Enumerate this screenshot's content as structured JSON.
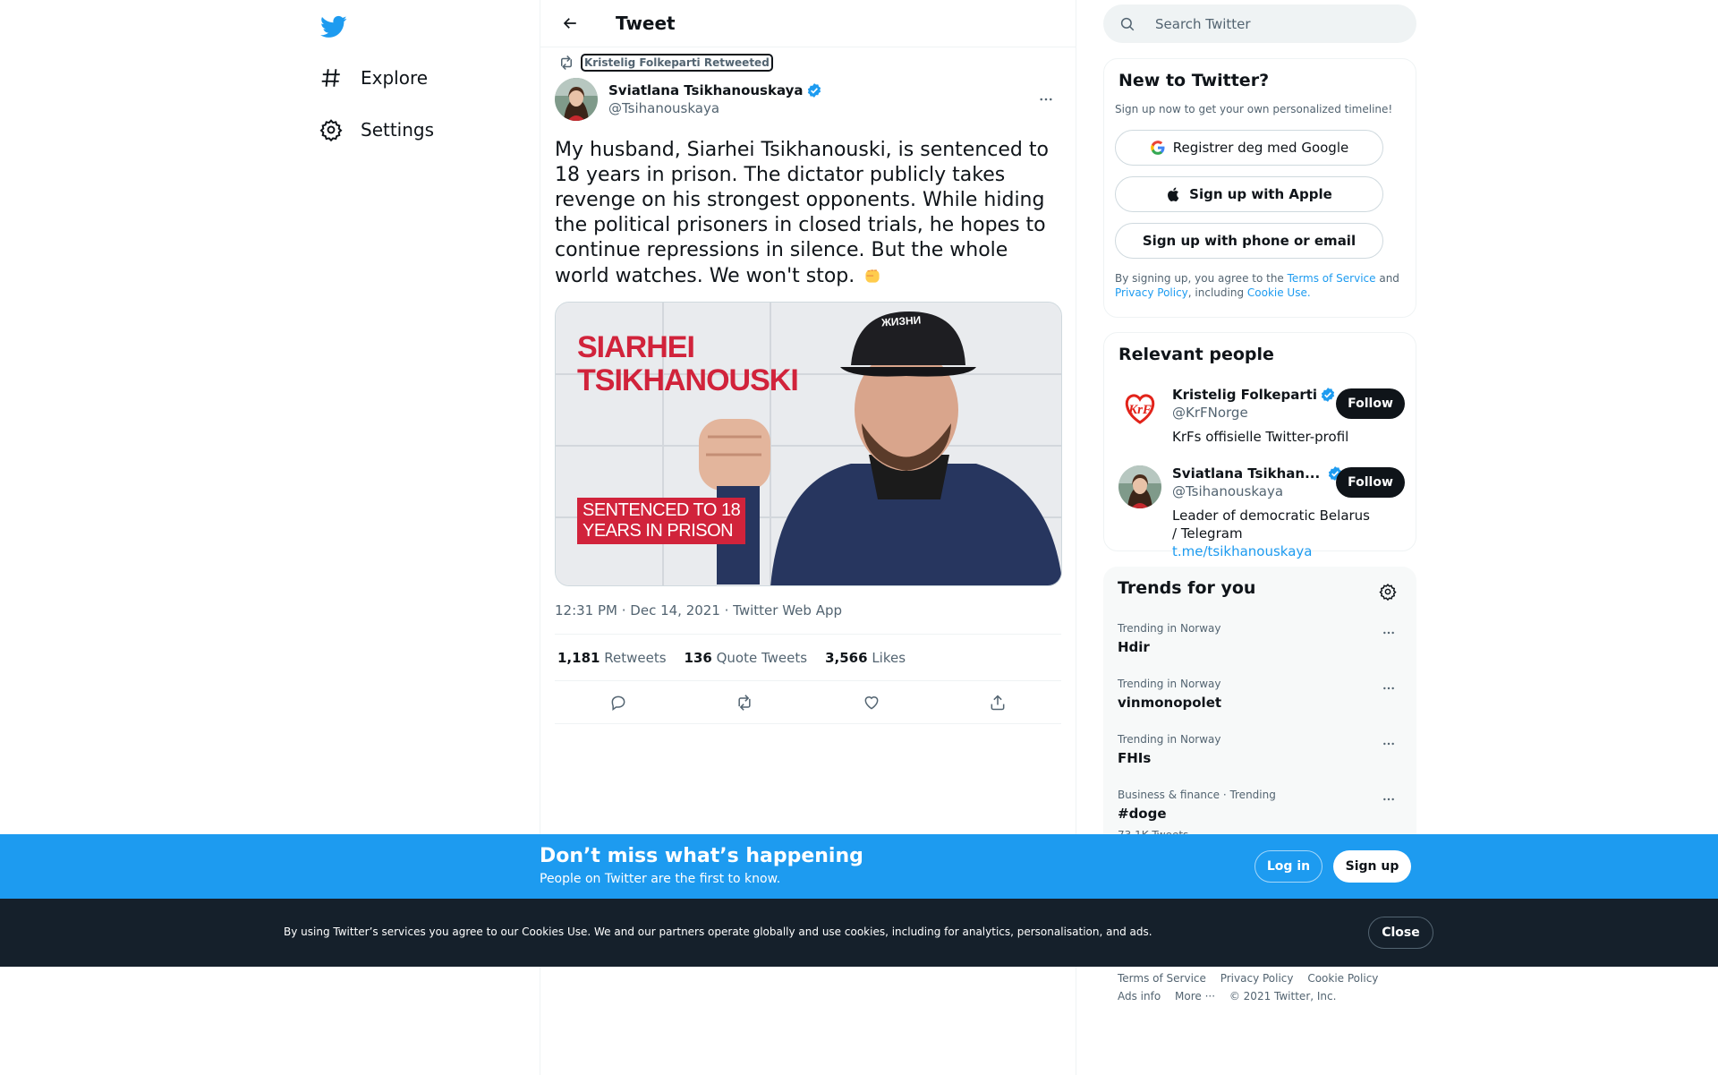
{
  "nav": {
    "logo": "twitter-logo",
    "items": [
      {
        "label": "Explore",
        "icon": "hashtag-icon"
      },
      {
        "label": "Settings",
        "icon": "gear-icon"
      }
    ]
  },
  "header": {
    "title": "Tweet",
    "back_icon": "arrow-left-icon"
  },
  "tweet": {
    "retweeted_by": "Kristelig Folkeparti Retweeted",
    "author_name": "Sviatlana Tsikhanouskaya",
    "author_handle": "@Tsihanouskaya",
    "text": "My husband, Siarhei Tsikhanouski, is sentenced to 18 years in prison. The dictator publicly takes revenge on his strongest opponents. While hiding the political prisoners in closed trials, he hopes to continue repressions in silence. But the whole world watches. We won't stop.",
    "emoji": "raised-fist-emoji",
    "media": {
      "title_line1": "SIARHEI",
      "title_line2": "TSIKHANOUSKI",
      "banner_line1": "SENTENCED TO 18",
      "banner_line2": "YEARS IN PRISON",
      "cap_text": "ЖИЗНИ"
    },
    "meta": "12:31 PM · Dec 14, 2021 · Twitter Web App",
    "stats": {
      "retweets": "1,181",
      "retweets_label": "Retweets",
      "quotes": "136",
      "quotes_label": "Quote Tweets",
      "likes": "3,566",
      "likes_label": "Likes"
    }
  },
  "search": {
    "placeholder": "Search Twitter"
  },
  "new_to_twitter": {
    "title": "New to Twitter?",
    "subtitle": "Sign up now to get your own personalized timeline!",
    "google_btn": "Registrer deg med Google",
    "apple_btn": "Sign up with Apple",
    "phone_btn": "Sign up with phone or email",
    "legal_1": "By signing up, you agree to the ",
    "legal_terms": "Terms of Service",
    "legal_2": " and ",
    "legal_privacy": "Privacy Policy",
    "legal_3": ", including ",
    "legal_cookie": "Cookie Use."
  },
  "relevant": {
    "title": "Relevant people",
    "people": [
      {
        "name": "Kristelig Folkeparti",
        "handle": "@KrFNorge",
        "bio": "KrFs offisielle Twitter-profil",
        "follow": "Follow",
        "avatar_text": "KrF"
      },
      {
        "name": "Sviatlana Tsikhan...",
        "handle": "@Tsihanouskaya",
        "bio": "Leader of democratic Belarus / Telegram ",
        "bio_link": "t.me/tsikhanouskaya",
        "follow": "Follow"
      }
    ]
  },
  "trends": {
    "title": "Trends for you",
    "items": [
      {
        "context": "Trending in Norway",
        "name": "Hdir"
      },
      {
        "context": "Trending in Norway",
        "name": "vinmonopolet"
      },
      {
        "context": "Trending in Norway",
        "name": "FHIs"
      },
      {
        "context": "Business & finance · Trending",
        "name": "#doge",
        "count": "73.1K Tweets"
      }
    ]
  },
  "footer": {
    "links": [
      "Terms of Service",
      "Privacy Policy",
      "Cookie Policy"
    ],
    "ads": "Ads info",
    "more": "More ···",
    "copyright": "© 2021 Twitter, Inc."
  },
  "signup_bar": {
    "title": "Don’t miss what’s happening",
    "subtitle": "People on Twitter are the first to know.",
    "login": "Log in",
    "signup": "Sign up"
  },
  "cookie_bar": {
    "text": "By using Twitter’s services you agree to our Cookies Use. We and our partners operate globally and use cookies, including for analytics, personalisation, and ads.",
    "close": "Close"
  },
  "colors": {
    "accent": "#1d9bf0",
    "dark": "#0f1419",
    "muted": "#536471",
    "cookie_bg": "#15202b",
    "banner_red": "#d1233b"
  }
}
